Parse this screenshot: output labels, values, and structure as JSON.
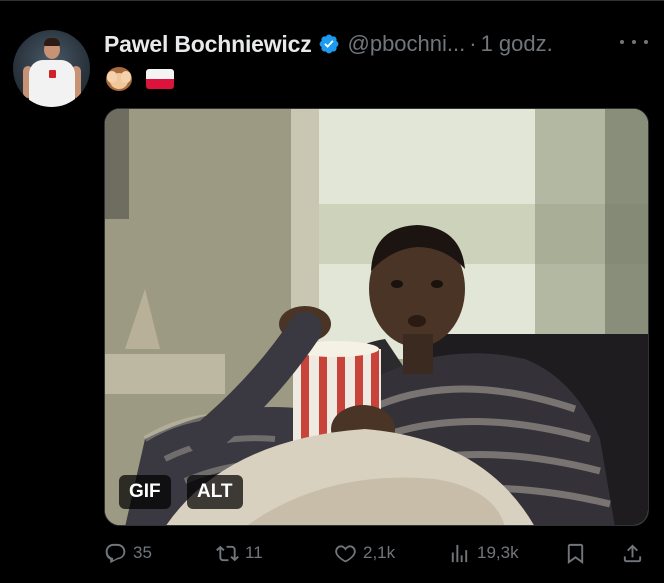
{
  "tweet": {
    "author_name": "Pawel Bochniewicz",
    "handle": "@pbochni...",
    "separator": "·",
    "time": "1 godz.",
    "text_emojis": [
      "see-no-evil-monkey",
      "poland-flag"
    ]
  },
  "media": {
    "gif_label": "GIF",
    "alt_label": "ALT"
  },
  "actions": {
    "replies": "35",
    "reposts": "11",
    "likes": "2,1k",
    "views": "19,3k"
  },
  "colors": {
    "background": "#000000",
    "text_primary": "#e7e9ea",
    "text_secondary": "#71767b",
    "verified": "#1d9bf0"
  },
  "icons": [
    "verified-badge-icon",
    "more-icon",
    "reply-icon",
    "repost-icon",
    "like-icon",
    "views-icon",
    "bookmark-icon",
    "share-icon"
  ]
}
